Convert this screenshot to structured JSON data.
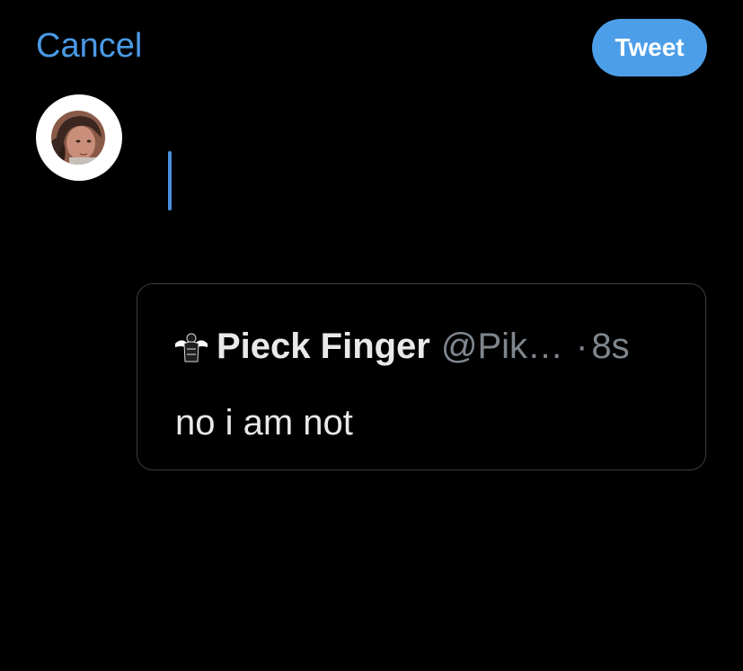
{
  "header": {
    "cancel_label": "Cancel",
    "tweet_label": "Tweet"
  },
  "composer": {
    "text": ""
  },
  "quoted_tweet": {
    "name": "Pieck Finger",
    "handle": "@Pik…",
    "separator": "·",
    "time": "8s",
    "text": "no i am not"
  },
  "colors": {
    "background": "#000000",
    "accent": "#4c9ee8",
    "secondary_text": "#7f868d",
    "border": "#3a3d41"
  }
}
